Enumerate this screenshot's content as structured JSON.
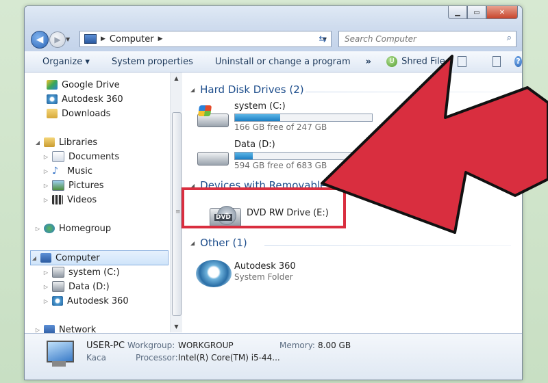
{
  "window": {
    "controls": {
      "minimize": "▁",
      "maximize": "▭",
      "close": "✕"
    }
  },
  "address": {
    "crumb": "Computer",
    "search_placeholder": "Search Computer"
  },
  "toolbar": {
    "organize": "Organize ▾",
    "system_properties": "System properties",
    "uninstall": "Uninstall or change a program",
    "more": "»",
    "shred": "Shred File"
  },
  "nav": {
    "favorites": [
      {
        "label": "Google Drive",
        "icon": "google-drive-icon"
      },
      {
        "label": "Autodesk 360",
        "icon": "autodesk-360-icon"
      },
      {
        "label": "Downloads",
        "icon": "downloads-icon"
      }
    ],
    "libraries": {
      "label": "Libraries",
      "icon": "libraries-icon"
    },
    "library_items": [
      {
        "label": "Documents",
        "icon": "documents-icon"
      },
      {
        "label": "Music",
        "icon": "music-icon"
      },
      {
        "label": "Pictures",
        "icon": "pictures-icon"
      },
      {
        "label": "Videos",
        "icon": "videos-icon"
      }
    ],
    "homegroup": {
      "label": "Homegroup",
      "icon": "homegroup-icon"
    },
    "computer": {
      "label": "Computer",
      "icon": "computer-icon"
    },
    "computer_items": [
      {
        "label": "system (C:)",
        "icon": "system-drive-icon"
      },
      {
        "label": "Data (D:)",
        "icon": "data-drive-icon"
      },
      {
        "label": "Autodesk 360",
        "icon": "autodesk-360-icon"
      }
    ],
    "network": {
      "label": "Network",
      "icon": "network-icon"
    }
  },
  "content": {
    "hdd_group": "Hard Disk Drives (2)",
    "drives": [
      {
        "name": "system (C:)",
        "free": "166 GB free of 247 GB",
        "used_fraction": 0.33
      },
      {
        "name": "Data (D:)",
        "free": "594 GB free of 683 GB",
        "used_fraction": 0.13
      }
    ],
    "removable_group": "Devices with Removable St",
    "dvd": {
      "name": "DVD RW Drive (E:)",
      "badge": "DVD"
    },
    "other_group": "Other (1)",
    "other_item": {
      "name": "Autodesk 360",
      "type": "System Folder"
    }
  },
  "status": {
    "computer_name": "USER-PC",
    "user": "Kaca",
    "workgroup_label": "Workgroup:",
    "workgroup_value": "WORKGROUP",
    "memory_label": "Memory:",
    "memory_value": "8.00 GB",
    "processor_label": "Processor:",
    "processor_value": "Intel(R) Core(TM) i5-44..."
  },
  "colors": {
    "highlight": "#d92e3f",
    "arrow_fill": "#d92e3f",
    "arrow_stroke": "#111111",
    "group_heading": "#1e4e8c",
    "bar_fill": "#1d7ec2"
  }
}
